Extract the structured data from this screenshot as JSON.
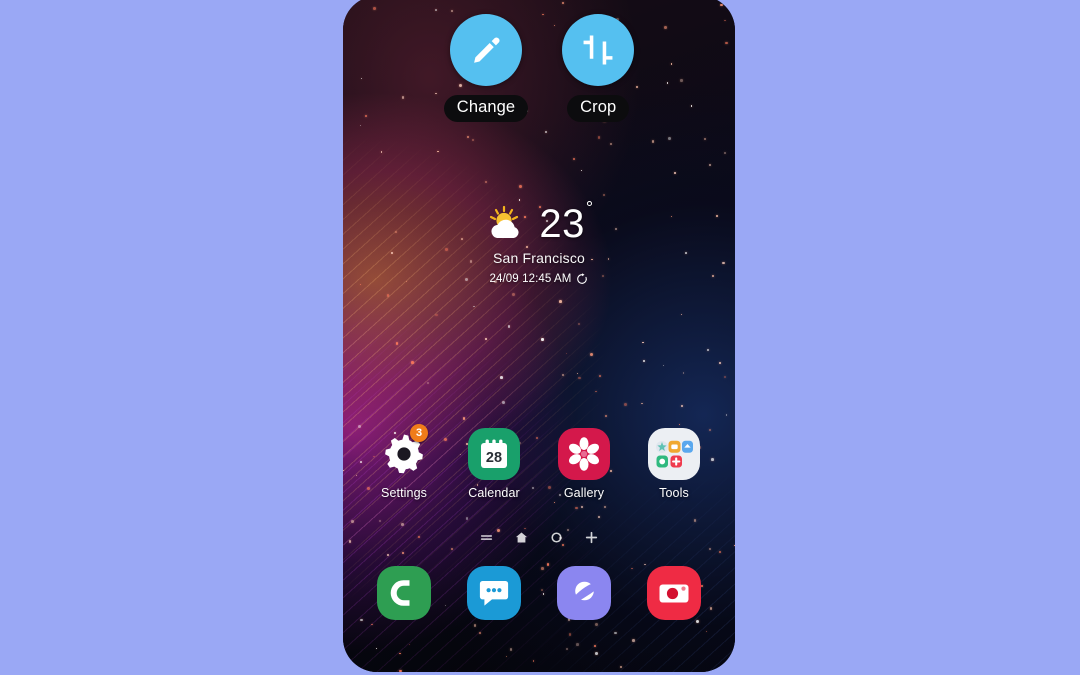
{
  "background": {
    "color": "#9aa8f5"
  },
  "phone": {
    "screen_bg": "#07060c",
    "wallpaper_description": "dark space wallpaper with diagonal orange magenta light streaks and star dots"
  },
  "top_actions": [
    {
      "icon": "pencil-icon",
      "label": "Change",
      "circle_color": "#55c0f0"
    },
    {
      "icon": "crop-icon",
      "label": "Crop",
      "circle_color": "#55c0f0"
    }
  ],
  "weather": {
    "icon": "sun-behind-cloud-icon",
    "temperature": "23",
    "degree_symbol": "°",
    "city": "San Francisco",
    "timestamp": "24/09 12:45 AM",
    "refresh_icon": "refresh-icon"
  },
  "apps": [
    {
      "name": "Settings",
      "icon": "gear-icon",
      "bg": "transparent",
      "badge": "3",
      "badge_color": "#f07c1a"
    },
    {
      "name": "Calendar",
      "icon": "calendar-icon",
      "bg": "#19a06b",
      "day": "28"
    },
    {
      "name": "Gallery",
      "icon": "flower-icon",
      "bg": "#d4184b"
    },
    {
      "name": "Tools",
      "icon": "folder-icon",
      "bg": "#eceff3"
    }
  ],
  "page_indicator": [
    {
      "icon": "list-lines-icon",
      "state": "inactive"
    },
    {
      "icon": "home-icon",
      "state": "active"
    },
    {
      "icon": "circle-icon",
      "state": "inactive"
    },
    {
      "icon": "plus-icon",
      "state": "inactive"
    }
  ],
  "dock": [
    {
      "name": "Phone",
      "icon": "phone-handset-icon",
      "bg": "#2e9e52"
    },
    {
      "name": "Messages",
      "icon": "chat-bubble-icon",
      "bg": "#1b9ad6"
    },
    {
      "name": "Internet",
      "icon": "planet-icon",
      "bg": "#8b86f0"
    },
    {
      "name": "Camera",
      "icon": "camera-icon",
      "bg": "#ef2b44"
    }
  ]
}
